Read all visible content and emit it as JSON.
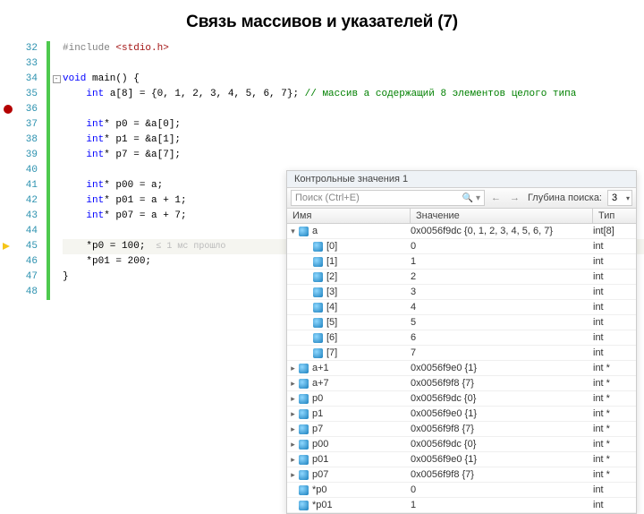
{
  "title": "Связь массивов и указателей (7)",
  "code": {
    "lines": [
      {
        "n": "32",
        "pre": "#include ",
        "inc": "<stdio.h>"
      },
      {
        "n": "33",
        "blank": true
      },
      {
        "n": "34",
        "fold": "-",
        "kw": "void",
        "txt": " main() {"
      },
      {
        "n": "35",
        "indent": "    ",
        "kw": "int",
        "txt": " a[8] = {0, 1, 2, 3, 4, 5, 6, 7}; ",
        "com": "// массив a содержащий 8 элементов целого типа"
      },
      {
        "n": "36",
        "bp": true,
        "blank": true
      },
      {
        "n": "37",
        "indent": "    ",
        "kw": "int",
        "txt": "* p0 = &a[0];"
      },
      {
        "n": "38",
        "indent": "    ",
        "kw": "int",
        "txt": "* p1 = &a[1];"
      },
      {
        "n": "39",
        "indent": "    ",
        "kw": "int",
        "txt": "* p7 = &a[7];"
      },
      {
        "n": "40",
        "blank": true
      },
      {
        "n": "41",
        "indent": "    ",
        "kw": "int",
        "txt": "* p00 = a;"
      },
      {
        "n": "42",
        "indent": "    ",
        "kw": "int",
        "txt": "* p01 = a + 1;"
      },
      {
        "n": "43",
        "indent": "    ",
        "kw": "int",
        "txt": "* p07 = a + 7;"
      },
      {
        "n": "44",
        "blank": true
      },
      {
        "n": "45",
        "arrow": true,
        "hl": true,
        "indent": "    ",
        "txt": "*p0 = 100;",
        "annot": "  ≤ 1 мс прошло"
      },
      {
        "n": "46",
        "indent": "    ",
        "txt": "*p01 = 200;"
      },
      {
        "n": "47",
        "txt": "}"
      },
      {
        "n": "48",
        "blank": true
      }
    ]
  },
  "watch": {
    "title": "Контрольные значения 1",
    "search_placeholder": "Поиск (Ctrl+E)",
    "nav_back": "←",
    "nav_fwd": "→",
    "depth_label": "Глубина поиска:",
    "depth_value": "3",
    "headers": {
      "name": "Имя",
      "value": "Значение",
      "type": "Тип"
    },
    "rows": [
      {
        "exp": "▾",
        "indent": 0,
        "name": "a",
        "value": "0x0056f9dc {0, 1, 2, 3, 4, 5, 6, 7}",
        "type": "int[8]"
      },
      {
        "exp": "",
        "indent": 1,
        "name": "[0]",
        "value": "0",
        "type": "int"
      },
      {
        "exp": "",
        "indent": 1,
        "name": "[1]",
        "value": "1",
        "type": "int"
      },
      {
        "exp": "",
        "indent": 1,
        "name": "[2]",
        "value": "2",
        "type": "int"
      },
      {
        "exp": "",
        "indent": 1,
        "name": "[3]",
        "value": "3",
        "type": "int"
      },
      {
        "exp": "",
        "indent": 1,
        "name": "[4]",
        "value": "4",
        "type": "int"
      },
      {
        "exp": "",
        "indent": 1,
        "name": "[5]",
        "value": "5",
        "type": "int"
      },
      {
        "exp": "",
        "indent": 1,
        "name": "[6]",
        "value": "6",
        "type": "int"
      },
      {
        "exp": "",
        "indent": 1,
        "name": "[7]",
        "value": "7",
        "type": "int"
      },
      {
        "exp": "▸",
        "indent": 0,
        "name": "a+1",
        "value": "0x0056f9e0 {1}",
        "type": "int *"
      },
      {
        "exp": "▸",
        "indent": 0,
        "name": "a+7",
        "value": "0x0056f9f8 {7}",
        "type": "int *"
      },
      {
        "exp": "▸",
        "indent": 0,
        "name": "p0",
        "value": "0x0056f9dc {0}",
        "type": "int *"
      },
      {
        "exp": "▸",
        "indent": 0,
        "name": "p1",
        "value": "0x0056f9e0 {1}",
        "type": "int *"
      },
      {
        "exp": "▸",
        "indent": 0,
        "name": "p7",
        "value": "0x0056f9f8 {7}",
        "type": "int *"
      },
      {
        "exp": "▸",
        "indent": 0,
        "name": "p00",
        "value": "0x0056f9dc {0}",
        "type": "int *"
      },
      {
        "exp": "▸",
        "indent": 0,
        "name": "p01",
        "value": "0x0056f9e0 {1}",
        "type": "int *"
      },
      {
        "exp": "▸",
        "indent": 0,
        "name": "p07",
        "value": "0x0056f9f8 {7}",
        "type": "int *",
        "red": true
      },
      {
        "exp": "",
        "indent": 0,
        "name": "*p0",
        "value": "0",
        "type": "int"
      },
      {
        "exp": "",
        "indent": 0,
        "name": "*p01",
        "value": "1",
        "type": "int"
      }
    ]
  }
}
